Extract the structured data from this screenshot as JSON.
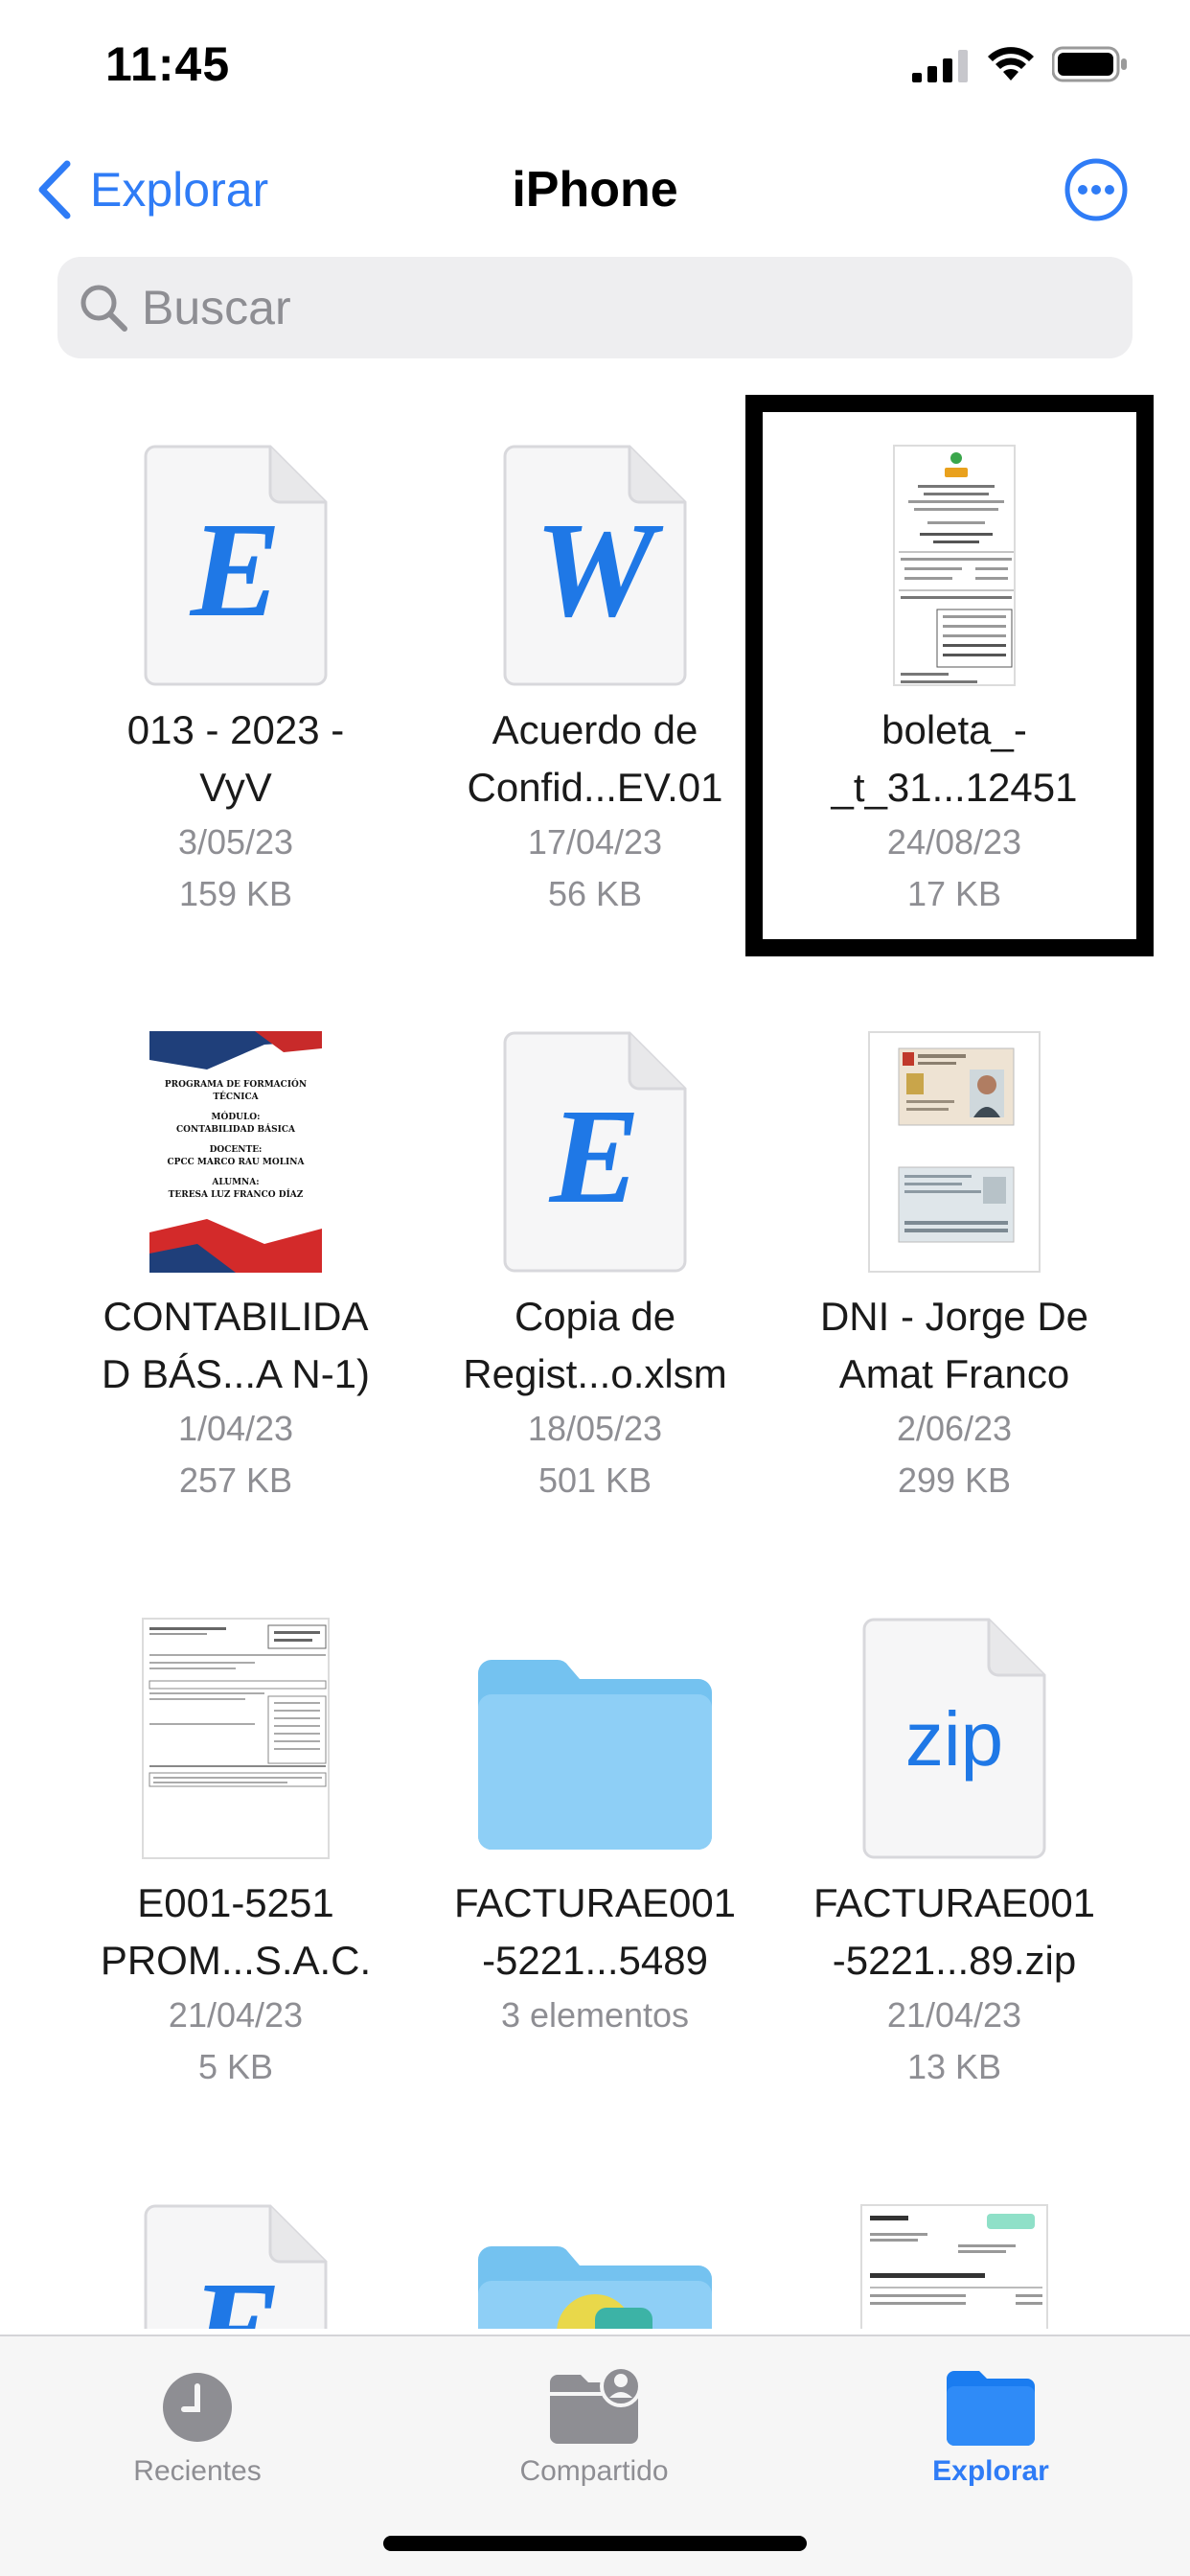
{
  "status_bar": {
    "time": "11:45"
  },
  "nav": {
    "back_label": "Explorar",
    "title": "iPhone"
  },
  "search": {
    "placeholder": "Buscar"
  },
  "files": [
    {
      "line1": "013 - 2023 -",
      "line2": "VyV",
      "date": "3/05/23",
      "size": "159 KB",
      "icon": "excel-doc-icon",
      "glyph": "E"
    },
    {
      "line1": "Acuerdo de",
      "line2": "Confid...EV.01",
      "date": "17/04/23",
      "size": "56 KB",
      "icon": "word-doc-icon",
      "glyph": "W"
    },
    {
      "line1": "boleta_-",
      "line2": "_t_31...12451",
      "date": "24/08/23",
      "size": "17 KB",
      "icon": "receipt-thumbnail"
    },
    {
      "line1": "CONTABILIDA",
      "line2": "D BÁS...A N-1)",
      "date": "1/04/23",
      "size": "257 KB",
      "icon": "pdf-cover-thumbnail",
      "cover": {
        "l1": "PROGRAMA DE FORMACIÓN",
        "l2": "TÉCNICA",
        "l3": "MÓDULO:",
        "l4": "CONTABILIDAD BÁSICA",
        "l5": "DOCENTE:",
        "l6": "CPCC MARCO RAU MOLINA",
        "l7": "ALUMNA:",
        "l8": "TERESA LUZ FRANCO DÍAZ"
      }
    },
    {
      "line1": "Copia de",
      "line2": "Regist...o.xlsm",
      "date": "18/05/23",
      "size": "501 KB",
      "icon": "excel-doc-icon",
      "glyph": "E"
    },
    {
      "line1": "DNI - Jorge De",
      "line2": "Amat Franco",
      "date": "2/06/23",
      "size": "299 KB",
      "icon": "id-card-thumbnail"
    },
    {
      "line1": "E001-5251",
      "line2": "PROM...S.A.C.",
      "date": "21/04/23",
      "size": "5 KB",
      "icon": "invoice-thumbnail"
    },
    {
      "line1": "FACTURAE001",
      "line2": "-5221...5489",
      "date": "",
      "size": "3 elementos",
      "icon": "folder-icon"
    },
    {
      "line1": "FACTURAE001",
      "line2": "-5221...89.zip",
      "date": "21/04/23",
      "size": "13 KB",
      "icon": "zip-doc-icon",
      "glyph": "zip"
    }
  ],
  "partial_row": [
    {
      "icon": "excel-doc-icon",
      "glyph": "E"
    },
    {
      "icon": "folder-icon"
    },
    {
      "icon": "receipt-thumbnail"
    }
  ],
  "tabs": [
    {
      "label": "Recientes",
      "icon": "clock-icon",
      "active": false
    },
    {
      "label": "Compartido",
      "icon": "shared-folder-icon",
      "active": false
    },
    {
      "label": "Explorar",
      "icon": "folder-icon",
      "active": true
    }
  ],
  "colors": {
    "accent": "#2f7cf6",
    "doc_glyph": "#1f78e6",
    "folder": "#8ecff6",
    "inactive": "#8e8e93"
  }
}
